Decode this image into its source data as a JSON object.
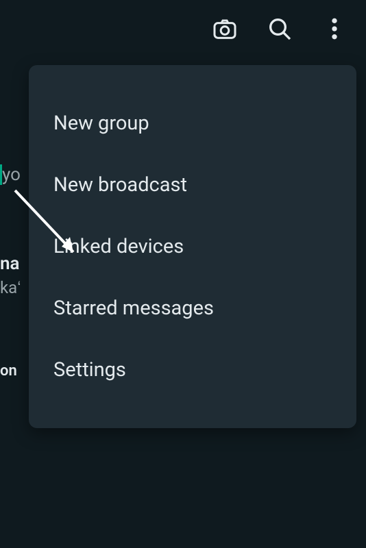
{
  "toolbar": {
    "camera_icon": "camera-icon",
    "search_icon": "search-icon",
    "more_icon": "more-vert-icon"
  },
  "menu": {
    "items": [
      {
        "label": "New group"
      },
      {
        "label": "New broadcast"
      },
      {
        "label": "Linked devices"
      },
      {
        "label": "Starred messages"
      },
      {
        "label": "Settings"
      }
    ]
  },
  "background": {
    "row1": "yo",
    "row2_bold": "na",
    "row2_sub": "kaʻ",
    "row3": "on"
  },
  "colors": {
    "bg": "#0f1a1f",
    "menu_bg": "#1f2c34",
    "text": "#e4eaed",
    "accent": "#00a884"
  }
}
